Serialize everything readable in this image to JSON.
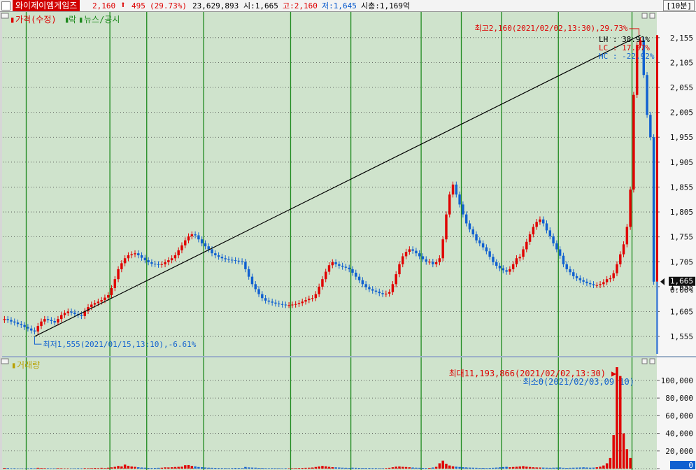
{
  "toolbar": {
    "stock_name": "와이제이엠게임즈",
    "price": "2,160",
    "change": "495",
    "change_pct": "(29.73%)",
    "volume": "23,629,893",
    "open": "시:1,665",
    "high": "고:2,160",
    "low": "저:1,645",
    "market_cap": "시총:1,169억",
    "interval": "[10분]",
    "colors": {
      "up": "#dd0000",
      "down": "#0055cc",
      "name_bg": "#d10000"
    }
  },
  "legend": {
    "price_label": "가격(수정)",
    "rak_label": "락",
    "news_label": "뉴스/공시",
    "volume_label": "거래량"
  },
  "chart_data": {
    "type": "candlestick",
    "background": "#cfe3cc",
    "grid": true,
    "price_panel": {
      "ylim": [
        1520,
        2180
      ],
      "yticks": [
        1555,
        1605,
        1655,
        1705,
        1755,
        1805,
        1855,
        1905,
        1955,
        2005,
        2055,
        2105,
        2155
      ],
      "ytick_labels": [
        "1,555",
        "1,605",
        "1,655",
        "1,705",
        "1,755",
        "1,805",
        "1,855",
        "1,905",
        "1,955",
        "2,005",
        "2,055",
        "2,105",
        "2,155"
      ],
      "current_price": "1,665",
      "current_pct": "0.00%",
      "max_annotation": "최고2,160(2021/02/02,13:30),29.73%",
      "min_annotation": "최저1,555(2021/01/15,13:10),-6.61%",
      "lh": "LH :  38.91%",
      "lc": "LC :  17.07%",
      "hc": "HC : -22.92%",
      "trendline_from": 1555,
      "trendline_to": 2160,
      "series": [
        {
          "name": "가격(수정)",
          "close": [
            1590,
            1588,
            1585,
            1583,
            1580,
            1578,
            1574,
            1571,
            1567,
            1565,
            1576,
            1585,
            1590,
            1588,
            1586,
            1583,
            1590,
            1598,
            1602,
            1605,
            1603,
            1600,
            1598,
            1596,
            1606,
            1614,
            1619,
            1622,
            1625,
            1628,
            1633,
            1638,
            1652,
            1670,
            1690,
            1702,
            1712,
            1718,
            1720,
            1722,
            1718,
            1713,
            1708,
            1704,
            1701,
            1700,
            1699,
            1700,
            1704,
            1708,
            1712,
            1718,
            1728,
            1738,
            1748,
            1756,
            1760,
            1758,
            1750,
            1742,
            1736,
            1730,
            1722,
            1718,
            1715,
            1712,
            1710,
            1709,
            1708,
            1707,
            1706,
            1705,
            1690,
            1675,
            1660,
            1650,
            1640,
            1632,
            1627,
            1625,
            1623,
            1621,
            1620,
            1619,
            1618,
            1618,
            1619,
            1620,
            1622,
            1625,
            1628,
            1631,
            1632,
            1640,
            1655,
            1670,
            1685,
            1698,
            1704,
            1700,
            1697,
            1695,
            1693,
            1690,
            1683,
            1675,
            1668,
            1660,
            1654,
            1650,
            1647,
            1645,
            1642,
            1640,
            1641,
            1644,
            1660,
            1680,
            1700,
            1716,
            1725,
            1730,
            1727,
            1722,
            1716,
            1710,
            1705,
            1705,
            1700,
            1704,
            1712,
            1750,
            1800,
            1840,
            1860,
            1840,
            1820,
            1800,
            1782,
            1770,
            1760,
            1748,
            1742,
            1734,
            1726,
            1715,
            1704,
            1697,
            1692,
            1688,
            1685,
            1690,
            1700,
            1712,
            1715,
            1730,
            1745,
            1760,
            1775,
            1785,
            1790,
            1782,
            1768,
            1756,
            1742,
            1730,
            1717,
            1700,
            1690,
            1684,
            1676,
            1672,
            1668,
            1665,
            1662,
            1660,
            1658,
            1658,
            1660,
            1664,
            1670,
            1672,
            1682,
            1700,
            1720,
            1740,
            1775,
            1850,
            2040,
            2140,
            2150,
            2080,
            2000,
            1955,
            1665
          ]
        }
      ]
    },
    "volume_panel": {
      "ylim": [
        0,
        115000
      ],
      "yticks": [
        0,
        20000,
        40000,
        60000,
        80000,
        100000
      ],
      "ytick_labels": [
        "0",
        "20,000",
        "40,000",
        "60,000",
        "80,000",
        "100,000"
      ],
      "max_annotation": "최대11,193,866(2021/02/02,13:30)",
      "min_annotation": "최소0(2021/02/03,09:10)",
      "values": [
        800,
        700,
        400,
        500,
        300,
        300,
        200,
        400,
        600,
        500,
        900,
        700,
        600,
        500,
        400,
        400,
        600,
        500,
        300,
        300,
        300,
        400,
        500,
        400,
        600,
        500,
        600,
        800,
        600,
        900,
        700,
        1000,
        1400,
        2000,
        3000,
        2500,
        4500,
        3200,
        2400,
        2000,
        1500,
        1200,
        1000,
        800,
        700,
        800,
        900,
        1000,
        1400,
        1300,
        1500,
        1800,
        2000,
        2200,
        3800,
        4000,
        3000,
        2500,
        1800,
        1500,
        1200,
        1000,
        900,
        800,
        700,
        600,
        600,
        500,
        600,
        800,
        700,
        600,
        1800,
        1300,
        1100,
        1000,
        800,
        700,
        600,
        500,
        600,
        500,
        500,
        400,
        500,
        400,
        500,
        600,
        700,
        800,
        900,
        1000,
        1200,
        1800,
        2400,
        3000,
        2600,
        2000,
        1600,
        1400,
        1200,
        1000,
        900,
        800,
        1000,
        900,
        800,
        700,
        700,
        700,
        600,
        600,
        500,
        500,
        600,
        900,
        1500,
        2200,
        2400,
        2000,
        1800,
        1500,
        1200,
        1000,
        900,
        800,
        700,
        800,
        1200,
        2000,
        6000,
        9000,
        5500,
        3500,
        2600,
        2200,
        1800,
        1500,
        1300,
        1100,
        1000,
        900,
        800,
        800,
        700,
        800,
        900,
        1100,
        1400,
        1700,
        2000,
        1500,
        1800,
        2100,
        2400,
        2800,
        2200,
        1800,
        1500,
        1300,
        1200,
        1100,
        1000,
        900,
        1000,
        1100,
        1200,
        900,
        800,
        900,
        1000,
        1100,
        1200,
        1400,
        1200,
        1000,
        1100,
        1500,
        2200,
        3500,
        6000,
        12000,
        38000,
        115000,
        105000,
        40000,
        22000,
        12000,
        0
      ]
    },
    "vertical_lines_at_bar": [
      7,
      32,
      43,
      60,
      86,
      104,
      125,
      137,
      149,
      166,
      188
    ],
    "colors": {
      "up": "#e00000",
      "down": "#1060d0",
      "grid": "#444444",
      "vline": "#1f8a1f",
      "trendline": "#000000"
    }
  }
}
